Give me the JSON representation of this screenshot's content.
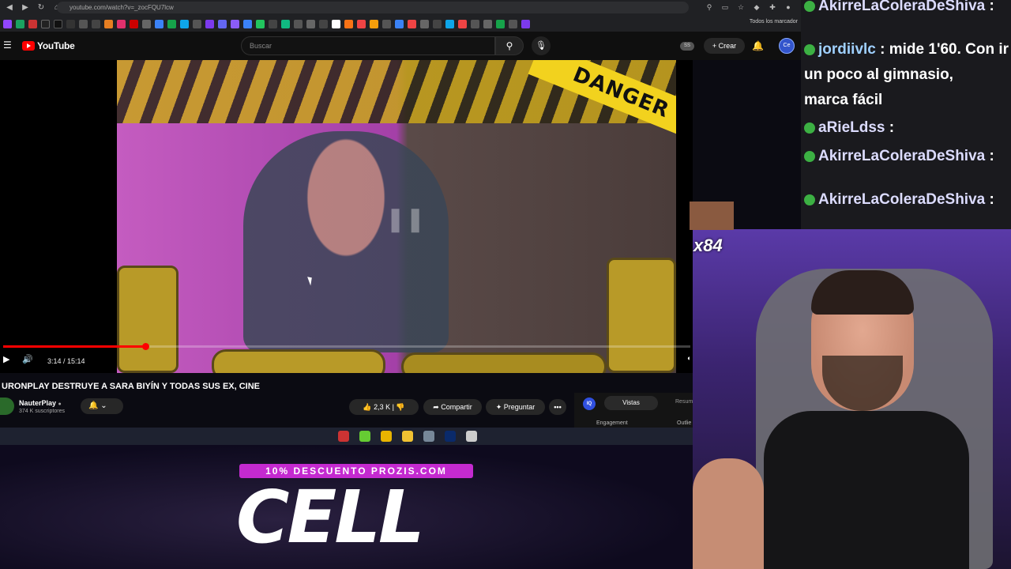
{
  "browser": {
    "url": "youtube.com/watch?v=_zocFQU7lcw",
    "bookmarks_all": "Todos los marcador"
  },
  "youtube": {
    "logo_text": "YouTube",
    "search_placeholder": "Buscar",
    "ss_badge": "SS",
    "create_label": "Crear",
    "avatar_label": "Ce"
  },
  "player": {
    "time": "3:14 / 15:14",
    "progress_fraction": 0.207,
    "danger_text": "DANGER"
  },
  "video": {
    "title": "URONPLAY DESTRUYE A SARA BIYÍN Y TODAS SUS EX, CINE",
    "channel_name": "NauterPlay",
    "subscribers": "374 K suscriptores",
    "likes": "2,3 K",
    "share_label": "Compartir",
    "ask_label": "Preguntar",
    "more_label": "•••"
  },
  "stats_panel": {
    "iq": "IQ",
    "tab_active": "Vistas",
    "tab_other": "Resum",
    "col1": "Engagement",
    "col2": "Outlie"
  },
  "overlay": {
    "promo": "10% DESCUENTO PROZIS.COM",
    "brand": "CELL",
    "emote_count": "x84"
  },
  "chat": [
    {
      "user": "AkirreLaColeraDeShiva",
      "sep": " :",
      "message": "",
      "color": "#dcdcff"
    },
    {
      "user": "jordiivlc",
      "sep": " :",
      "message": " mide 1'60. Con ir",
      "color": "#9fd0ff"
    },
    {
      "user": "",
      "sep": "",
      "message": "un poco al gimnasio,",
      "color": "#ffffff"
    },
    {
      "user": "",
      "sep": "",
      "message": "marca fácil",
      "color": "#ffffff"
    },
    {
      "user": "aRieLdss",
      "sep": " :",
      "message": "",
      "color": "#dcdcff"
    },
    {
      "user": "AkirreLaColeraDeShiva",
      "sep": " :",
      "message": "",
      "color": "#dcdcff"
    },
    {
      "user": "AkirreLaColeraDeShiva",
      "sep": " :",
      "message": "",
      "color": "#dcdcff"
    }
  ]
}
